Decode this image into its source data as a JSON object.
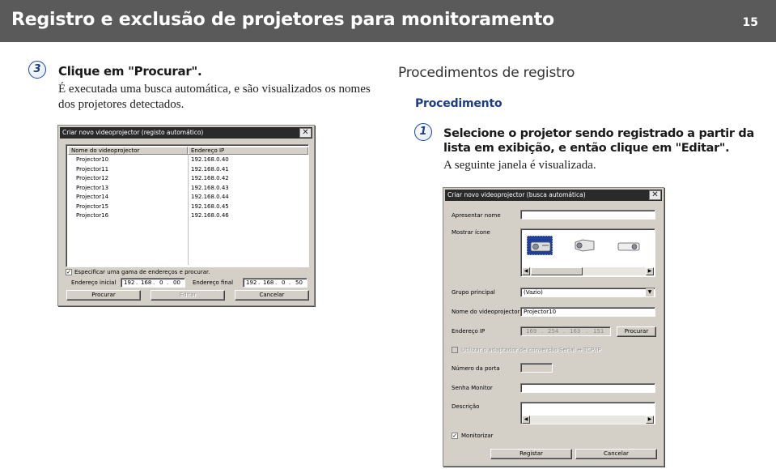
{
  "header": {
    "title": "Registro e exclusão de projetores para monitoramento",
    "page_number": "15"
  },
  "step3": {
    "number": "3",
    "title": "Clique em \"Procurar\".",
    "text": "É executada uma busca automática, e são visualizados os nomes dos projetores detectados."
  },
  "procedures": {
    "heading": "Procedimentos de registro",
    "subheading": "Procedimento"
  },
  "step1": {
    "number": "1",
    "title": "Selecione o projetor sendo registrado a partir da lista em exibição, e então clique em \"Editar\".",
    "text": "A seguinte janela é visualizada."
  },
  "dialog_search": {
    "title": "Criar novo videoprojector (registo automático)",
    "columns": [
      "Nome do videoprojector",
      "Endereço IP"
    ],
    "rows": [
      {
        "name": "Projector10",
        "ip": "192.168.0.40"
      },
      {
        "name": "Projector11",
        "ip": "192.168.0.41"
      },
      {
        "name": "Projector12",
        "ip": "192.168.0.42"
      },
      {
        "name": "Projector13",
        "ip": "192.168.0.43"
      },
      {
        "name": "Projector14",
        "ip": "192.168.0.44"
      },
      {
        "name": "Projector15",
        "ip": "192.168.0.45"
      },
      {
        "name": "Projector16",
        "ip": "192.168.0.46"
      }
    ],
    "range_checkbox_label": "Especificar uma gama de endereços e procurar.",
    "range_checked": true,
    "start_label": "Endereço inicial",
    "start_ip": [
      "192",
      "168",
      "0",
      "00"
    ],
    "end_label": "Endereço final",
    "end_ip": [
      "192",
      "168",
      "0",
      "50"
    ],
    "buttons": {
      "search": "Procurar",
      "edit": "Editar",
      "cancel": "Cancelar"
    }
  },
  "dialog_edit": {
    "title": "Criar novo videoprojector (busca automática)",
    "display_name_label": "Apresentar nome",
    "display_name_value": "",
    "icon_label": "Mostrar ícone",
    "icons": [
      "projector-icon-1",
      "projector-icon-2",
      "projector-icon-3"
    ],
    "group_label": "Grupo principal",
    "group_value": "(Vazio)",
    "projector_name_label": "Nome do videoprojector",
    "projector_name_value": "Projector10",
    "ip_label": "Endereço IP",
    "ip_value": [
      "169",
      "254",
      "163",
      "151"
    ],
    "ip_search_button": "Procurar",
    "adapter_checkbox_label": "Utilizar o adaptador de conversão Serial ↔ TCP/IP",
    "port_label": "Número da porta",
    "monitor_password_label": "Senha Monitor",
    "description_label": "Descrição",
    "monitor_checkbox_label": "Monitorizar",
    "monitor_checked": true,
    "buttons": {
      "register": "Registar",
      "cancel": "Cancelar"
    }
  }
}
